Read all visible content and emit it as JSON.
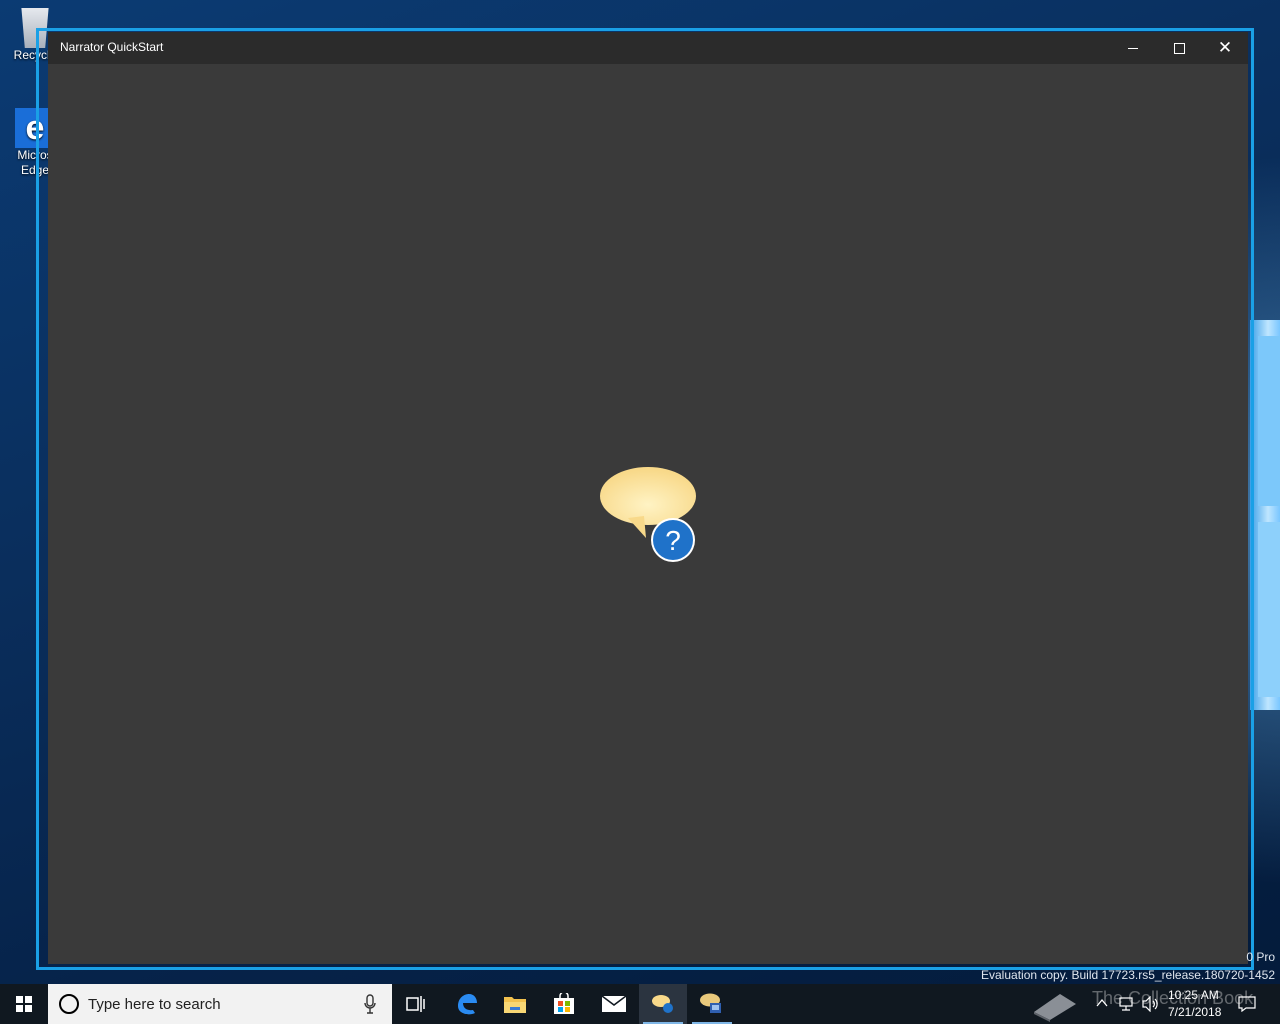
{
  "desktop": {
    "icons": [
      {
        "label": "Recycle",
        "icon": "recycle-bin-icon"
      },
      {
        "label": "Micros Edge",
        "icon": "edge-icon"
      }
    ],
    "watermark_edition": "0 Pro",
    "watermark_build": "Evaluation copy. Build 17723.rs5_release.180720-1452"
  },
  "window": {
    "title": "Narrator QuickStart",
    "buttons": {
      "minimize": "minimize",
      "maximize": "maximize",
      "close": "close"
    },
    "content_icon": "narrator-speech-bubble-icon"
  },
  "taskbar": {
    "search_placeholder": "Type here to search",
    "apps": [
      "task-view-icon",
      "edge-icon",
      "file-explorer-icon",
      "store-icon",
      "mail-icon",
      "narrator-icon",
      "narrator-settings-icon"
    ],
    "active_app": "narrator-icon",
    "clock_time": "10:25 AM",
    "clock_date": "7/21/2018",
    "watermark": "The Collection Book"
  },
  "colors": {
    "focus_rect": "#1aa0e6",
    "window_bg": "#3a3a3a",
    "titlebar_bg": "#2b2b2b",
    "taskbar_bg": "#101820"
  }
}
